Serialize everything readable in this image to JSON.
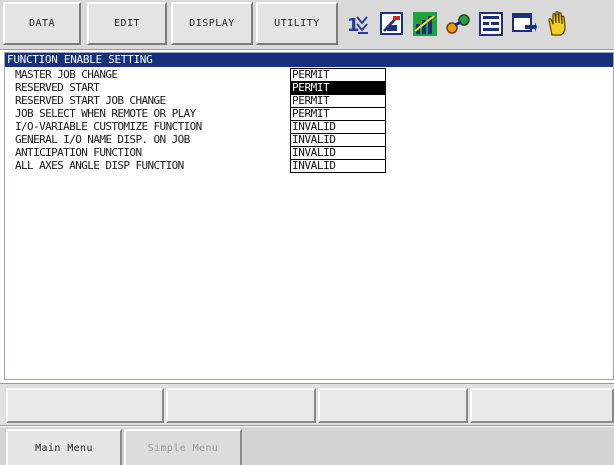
{
  "menu": {
    "items": [
      {
        "label": "DATA"
      },
      {
        "label": "EDIT"
      },
      {
        "label": "DISPLAY"
      },
      {
        "label": "UTILITY"
      }
    ],
    "icons": [
      "numbered-steps-icon",
      "edit-window-icon",
      "chart-status-icon",
      "robot-link-icon",
      "io-panel-icon",
      "window-arrow-icon",
      "hand-icon"
    ]
  },
  "screen": {
    "title": "FUNCTION ENABLE SETTING",
    "rows": [
      {
        "label": "MASTER JOB CHANGE",
        "value": "PERMIT",
        "selected": false
      },
      {
        "label": "RESERVED START",
        "value": "PERMIT",
        "selected": true
      },
      {
        "label": "RESERVED START JOB CHANGE",
        "value": "PERMIT",
        "selected": false
      },
      {
        "label": "JOB SELECT WHEN REMOTE OR PLAY",
        "value": "PERMIT",
        "selected": false
      },
      {
        "label": "I/O-VARIABLE CUSTOMIZE FUNCTION",
        "value": "INVALID",
        "selected": false
      },
      {
        "label": "GENERAL I/O NAME DISP. ON JOB",
        "value": "INVALID",
        "selected": false
      },
      {
        "label": "ANTICIPATION FUNCTION",
        "value": "INVALID",
        "selected": false
      },
      {
        "label": "ALL AXES ANGLE DISP FUNCTION",
        "value": "INVALID",
        "selected": false
      }
    ]
  },
  "bottom": {
    "tabs": [
      {
        "label": "Main Menu"
      },
      {
        "label": "Simple Menu"
      }
    ]
  },
  "colors": {
    "title_bar": "#17307a",
    "selected_value": "#000000"
  }
}
